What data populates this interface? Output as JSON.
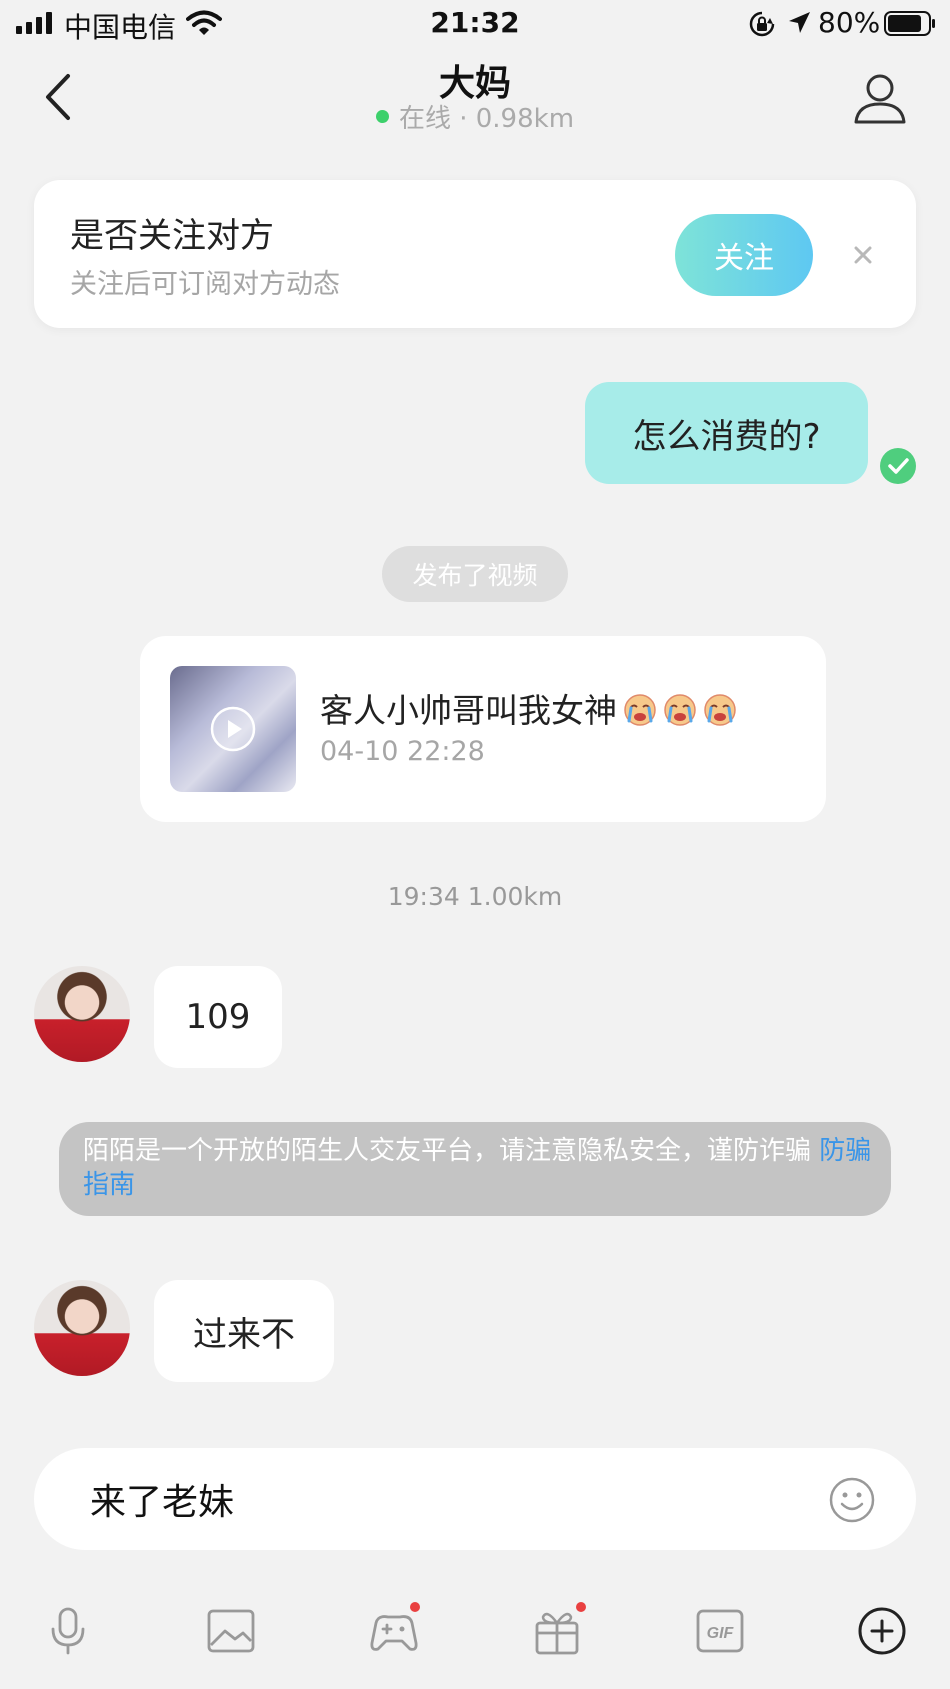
{
  "status_bar": {
    "carrier": "中国电信",
    "time": "21:32",
    "battery": "80%"
  },
  "header": {
    "title": "大妈",
    "presence": "在线 · 0.98km"
  },
  "follow_card": {
    "title": "是否关注对方",
    "subtitle": "关注后可订阅对方动态",
    "button": "关注"
  },
  "messages": {
    "outgoing_1": "怎么消费的?",
    "system_pill": "发布了视频",
    "video": {
      "title": "客人小帅哥叫我女神",
      "date": "04-10 22:28",
      "emoji_icons": [
        "crying-face-icon",
        "crying-face-icon",
        "crying-face-icon"
      ]
    },
    "timestamp": "19:34  1.00km",
    "incoming_1": "109",
    "warning": {
      "text": "陌陌是一个开放的陌生人交友平台，请注意隐私安全，谨防诈骗",
      "link": "防骗指南"
    },
    "incoming_2": "过来不"
  },
  "input": {
    "value": "来了老妹"
  },
  "toolbar": {
    "icons": [
      "microphone-icon",
      "image-icon",
      "game-controller-icon",
      "gift-icon",
      "gif-icon",
      "plus-circle-icon"
    ]
  },
  "colors": {
    "accent_gradient_start": "#7ee3d8",
    "accent_gradient_end": "#5ec8f2",
    "outgoing_bubble": "#a7ece9",
    "online_dot": "#3dd06b",
    "link": "#3a95e8",
    "badge": "#e94040"
  }
}
